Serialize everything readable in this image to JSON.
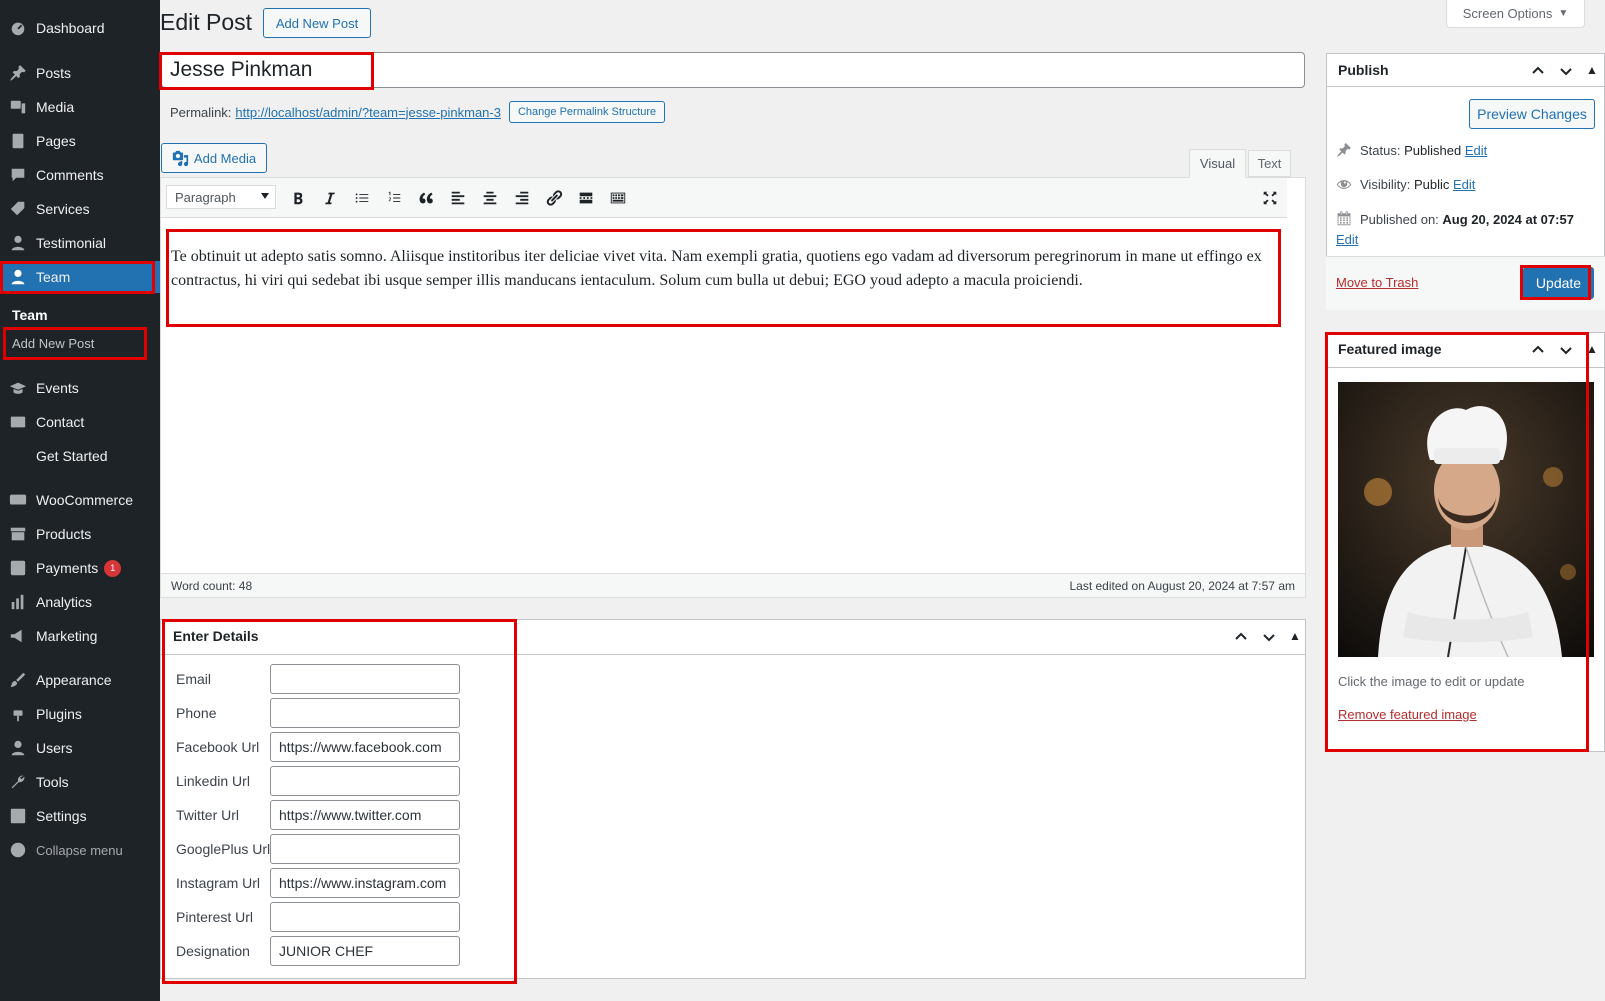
{
  "sidebar": {
    "items": [
      {
        "label": "Dashboard",
        "icon": "dashboard-icon"
      },
      {
        "label": "Posts",
        "icon": "pin-icon"
      },
      {
        "label": "Media",
        "icon": "media-icon"
      },
      {
        "label": "Pages",
        "icon": "pages-icon"
      },
      {
        "label": "Comments",
        "icon": "comments-icon"
      },
      {
        "label": "Services",
        "icon": "tag-icon"
      },
      {
        "label": "Testimonial",
        "icon": "user-icon"
      },
      {
        "label": "Team",
        "icon": "user-icon"
      },
      {
        "label": "Events",
        "icon": "education-icon"
      },
      {
        "label": "Contact",
        "icon": "mail-icon"
      },
      {
        "label": "Get Started",
        "icon": ""
      },
      {
        "label": "WooCommerce",
        "icon": "woo-icon"
      },
      {
        "label": "Products",
        "icon": "archive-icon"
      },
      {
        "label": "Payments",
        "icon": "payments-icon",
        "badge": "1"
      },
      {
        "label": "Analytics",
        "icon": "chart-icon"
      },
      {
        "label": "Marketing",
        "icon": "megaphone-icon"
      },
      {
        "label": "Appearance",
        "icon": "brush-icon"
      },
      {
        "label": "Plugins",
        "icon": "plugin-icon"
      },
      {
        "label": "Users",
        "icon": "users-icon"
      },
      {
        "label": "Tools",
        "icon": "wrench-icon"
      },
      {
        "label": "Settings",
        "icon": "settings-icon"
      },
      {
        "label": "Collapse menu",
        "icon": "collapse-icon"
      }
    ],
    "submenu_title": "Team",
    "submenu_item": "Add New Post"
  },
  "header": {
    "title": "Edit Post",
    "add_new": "Add New Post",
    "screen_options": "Screen Options"
  },
  "post": {
    "title": "Jesse Pinkman",
    "permalink_label": "Permalink:",
    "permalink_url": "http://localhost/admin/?team=jesse-pinkman-3",
    "change_permalink": "Change Permalink Structure",
    "add_media": "Add Media",
    "tab_visual": "Visual",
    "tab_text": "Text",
    "format": "Paragraph",
    "content": "Te obtinuit ut adepto satis somno. Aliisque institoribus iter deliciae vivet vita. Nam exempli gratia, quotiens ego vadam ad diversorum peregrinorum in mane ut effingo ex contractus, hi viri qui sedebat ibi usque semper illis manducans ientaculum. Solum cum bulla ut debui; EGO youd adepto a macula proiciendi.",
    "word_count": "Word count: 48",
    "last_edited": "Last edited on August 20, 2024 at 7:57 am"
  },
  "details": {
    "title": "Enter Details",
    "fields": [
      {
        "label": "Email",
        "value": ""
      },
      {
        "label": "Phone",
        "value": ""
      },
      {
        "label": "Facebook Url",
        "value": "https://www.facebook.com"
      },
      {
        "label": "Linkedin Url",
        "value": ""
      },
      {
        "label": "Twitter Url",
        "value": "https://www.twitter.com"
      },
      {
        "label": "GooglePlus Url",
        "value": ""
      },
      {
        "label": "Instagram Url",
        "value": "https://www.instagram.com"
      },
      {
        "label": "Pinterest Url",
        "value": ""
      },
      {
        "label": "Designation",
        "value": "JUNIOR CHEF"
      }
    ]
  },
  "publish": {
    "title": "Publish",
    "preview": "Preview Changes",
    "status_label": "Status:",
    "status_value": "Published",
    "visibility_label": "Visibility:",
    "visibility_value": "Public",
    "published_label": "Published on:",
    "published_value": "Aug 20, 2024 at 07:57",
    "edit": "Edit",
    "trash": "Move to Trash",
    "update": "Update"
  },
  "featured": {
    "title": "Featured image",
    "note": "Click the image to edit or update",
    "remove": "Remove featured image"
  },
  "colors": {
    "accent": "#2271b1",
    "sidebar": "#1d2327",
    "highlight": "#e00000"
  }
}
